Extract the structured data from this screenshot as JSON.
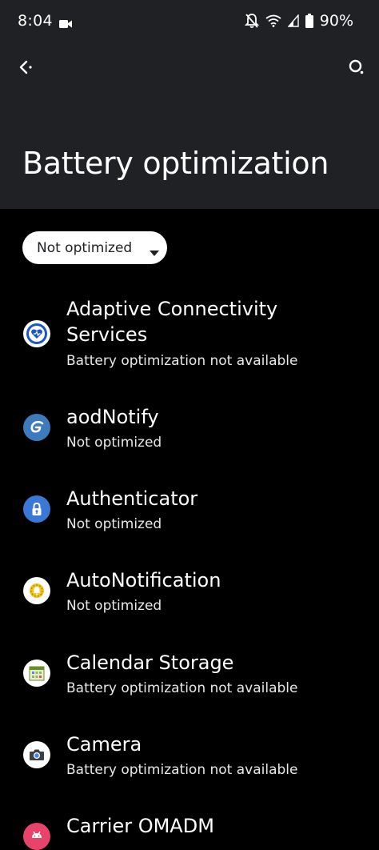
{
  "status_bar": {
    "time": "8:04",
    "battery": "90%",
    "icons": [
      "video-camera-icon",
      "notifications-off-icon",
      "wifi-icon",
      "signal-icon",
      "battery-icon"
    ]
  },
  "toolbar": {
    "back_icon": "back-arrow-icon",
    "search_icon": "search-icon"
  },
  "header": {
    "title": "Battery optimization"
  },
  "filter": {
    "selected": "Not optimized"
  },
  "apps": [
    {
      "name_line1": "Adaptive Connectivity",
      "name_line2": "Services",
      "status": "Battery optimization not available",
      "icon": "adaptive-connectivity-icon"
    },
    {
      "name": "aodNotify",
      "status": "Not optimized",
      "icon": "aodnotify-icon"
    },
    {
      "name": "Authenticator",
      "status": "Not optimized",
      "icon": "authenticator-icon"
    },
    {
      "name": "AutoNotification",
      "status": "Not optimized",
      "icon": "autonotification-icon"
    },
    {
      "name": "Calendar Storage",
      "status": "Battery optimization not available",
      "icon": "calendar-storage-icon"
    },
    {
      "name": "Camera",
      "status": "Battery optimization not available",
      "icon": "camera-icon"
    },
    {
      "name": "Carrier OMADM",
      "icon": "android-icon"
    }
  ],
  "colors": {
    "header_bg": "#202124",
    "page_bg": "#000000",
    "chip_bg": "#ffffff"
  }
}
